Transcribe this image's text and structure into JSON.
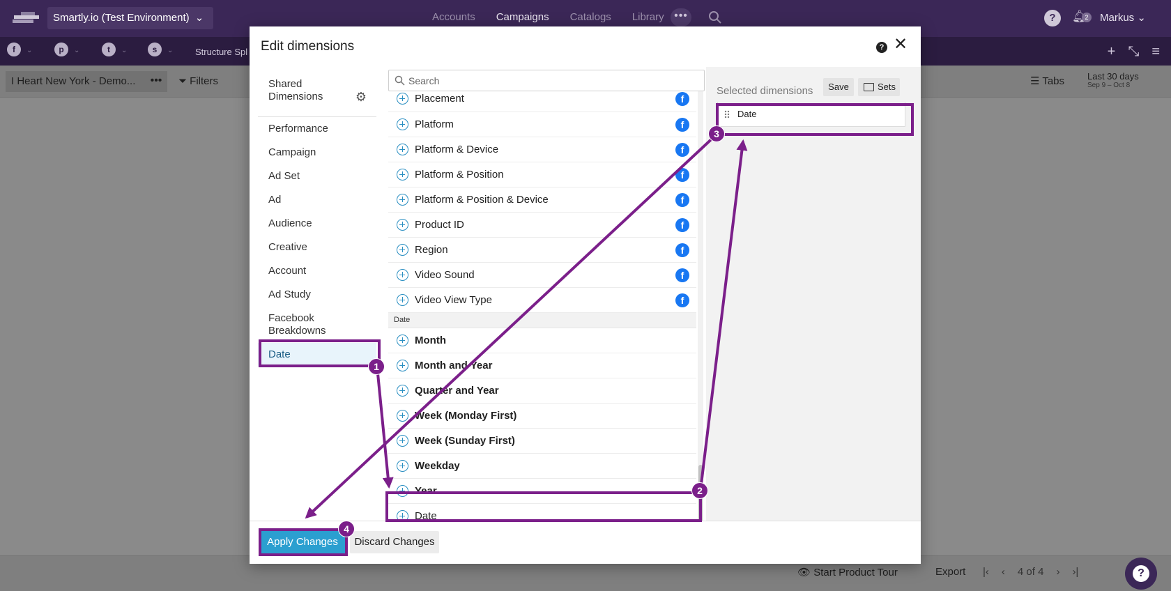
{
  "topbar": {
    "env_label": "Smartly.io (Test Environment)",
    "nav": [
      {
        "label": "Accounts"
      },
      {
        "label": "Campaigns"
      },
      {
        "label": "Catalogs"
      },
      {
        "label": "Library"
      }
    ],
    "more": "•••",
    "help": "?",
    "notification_count": "2",
    "user": "Markus"
  },
  "bar2": {
    "platforms": [
      "f",
      "p",
      "t",
      "s"
    ],
    "structure": "Structure Spl"
  },
  "bar3": {
    "tab_name": "I Heart New York - Demo...",
    "tab_more": "•••",
    "filters": "Filters",
    "tabs": "Tabs",
    "date_range": "Last 30 days",
    "date_sub": "Sep 9 – Oct 8"
  },
  "bottombar": {
    "tour": "Start Product Tour",
    "export": "Export",
    "pager": "4 of 4"
  },
  "modal": {
    "title": "Edit dimensions",
    "categories": [
      {
        "label": "Shared Dimensions"
      },
      {
        "label": "Performance"
      },
      {
        "label": "Campaign"
      },
      {
        "label": "Ad Set"
      },
      {
        "label": "Ad"
      },
      {
        "label": "Audience"
      },
      {
        "label": "Creative"
      },
      {
        "label": "Account"
      },
      {
        "label": "Ad Study"
      },
      {
        "label": "Facebook Breakdowns"
      },
      {
        "label": "Date"
      }
    ],
    "search_placeholder": "Search",
    "facebook_dims": [
      {
        "label": "Placement"
      },
      {
        "label": "Platform"
      },
      {
        "label": "Platform & Device"
      },
      {
        "label": "Platform & Position"
      },
      {
        "label": "Platform & Position & Device"
      },
      {
        "label": "Product ID"
      },
      {
        "label": "Region"
      },
      {
        "label": "Video Sound"
      },
      {
        "label": "Video View Type"
      }
    ],
    "group_date": "Date",
    "date_dims": [
      {
        "label": "Month"
      },
      {
        "label": "Month and Year"
      },
      {
        "label": "Quarter and Year"
      },
      {
        "label": "Week (Monday First)"
      },
      {
        "label": "Week (Sunday First)"
      },
      {
        "label": "Weekday"
      },
      {
        "label": "Year"
      },
      {
        "label": "Date"
      }
    ],
    "selected_title": "Selected dimensions",
    "save": "Save",
    "sets": "Sets",
    "selected": [
      {
        "label": "Date"
      }
    ],
    "apply": "Apply Changes",
    "discard": "Discard Changes"
  },
  "annotations": {
    "color": "#7b1f8a",
    "steps": [
      "1",
      "2",
      "3",
      "4"
    ]
  }
}
